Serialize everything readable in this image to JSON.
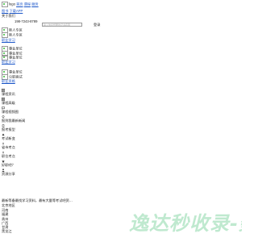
{
  "header": {
    "logo_alt": "logo",
    "nav": [
      "首页",
      "课程",
      "服务"
    ],
    "sub_links": [
      "图书",
      "下载APP"
    ],
    "about": "关于我们",
    "phone": "198-7243-8789",
    "search_placeholder": "输入你最想要的证书名称",
    "login": "登录"
  },
  "menu": [
    {
      "img_alt": "新人专区",
      "label": "新人专区"
    },
    {
      "img_alt": "新人专区",
      "label": "新人专区"
    },
    {
      "img_alt": "职业学习",
      "label": "职业学习"
    }
  ],
  "promo": [
    {
      "label": "事业单位"
    },
    {
      "label": "事业单位"
    },
    {
      "label": "事业单位"
    }
  ],
  "promo_links": [
    "职业学习"
  ],
  "cert": [
    {
      "label": "事业单位"
    },
    {
      "label": "公职面试"
    }
  ],
  "cert_link": "职业资格",
  "sidebar": [
    {
      "icon": "grid-icon",
      "label": "课程资讯"
    },
    {
      "icon": "grid-icon",
      "label": "课程高级"
    },
    {
      "icon": "pin-icon",
      "label": "课程视频图"
    },
    {
      "icon": "location-icon",
      "label": "报到我最新新闻"
    },
    {
      "icon": "phone-icon",
      "label": "报考报型"
    },
    {
      "icon": "up-icon",
      "label": "考试新变"
    },
    {
      "icon": "compass-icon",
      "label": "省市考点"
    },
    {
      "icon": "compass-icon",
      "label": "职位考点"
    },
    {
      "icon": "star-icon",
      "label": "好职吧？"
    },
    {
      "icon": "user-icon",
      "label": "资源分享"
    }
  ],
  "footer": {
    "desc": "最新等备最找学习资料，最有大量等考试吧资…",
    "region_title": "北京地区",
    "regions": [
      "河南",
      "福建",
      "贵州",
      "广西",
      "甘肃",
      "黑龙江"
    ]
  },
  "watermark": "逸达秒收录-数"
}
